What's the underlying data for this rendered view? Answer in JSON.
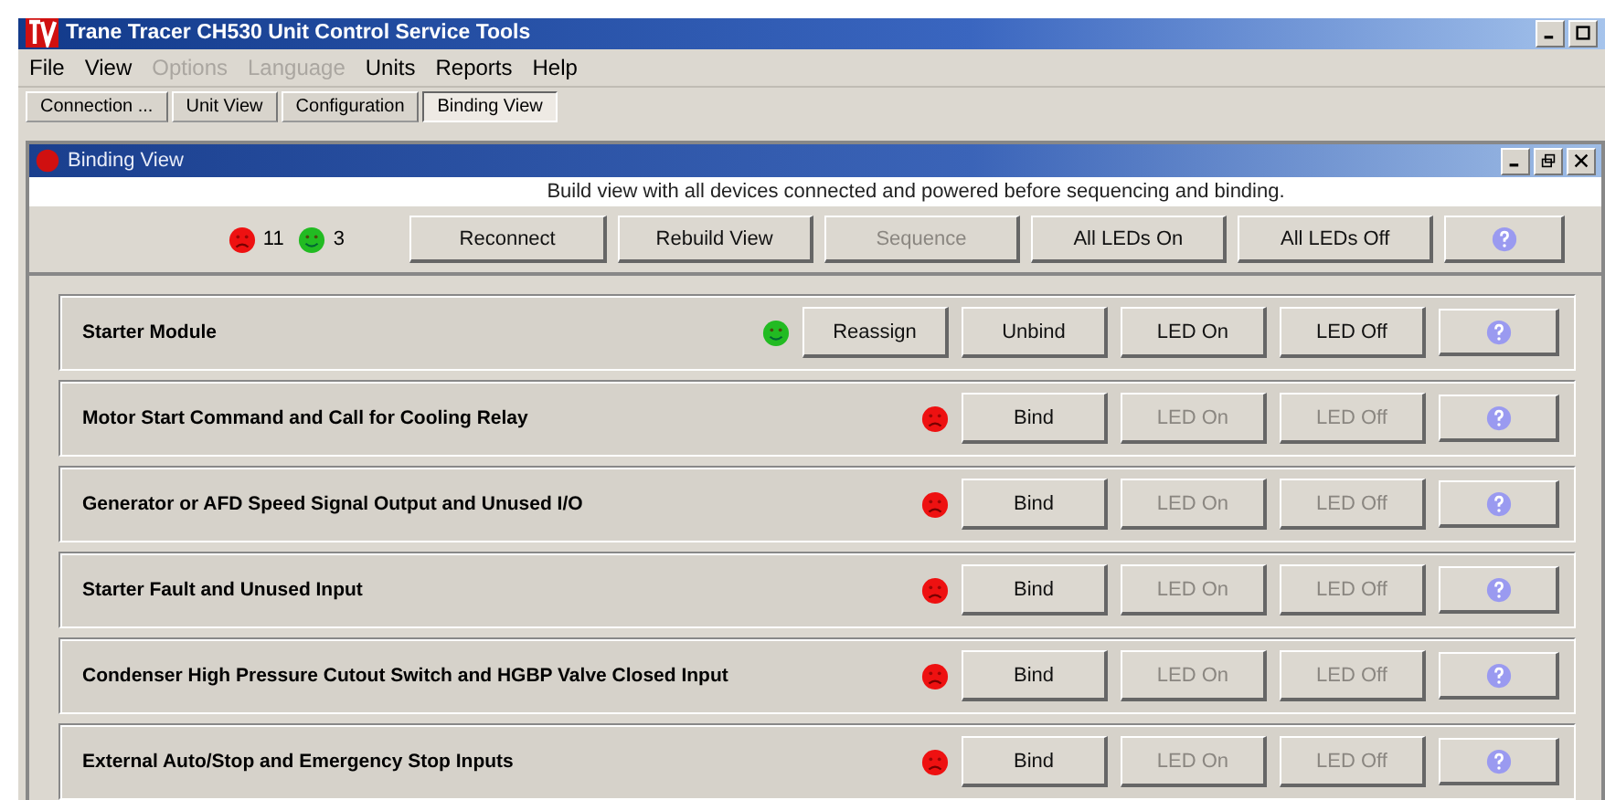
{
  "window": {
    "title": "Trane Tracer CH530 Unit Control Service Tools"
  },
  "menu": [
    {
      "label": "File",
      "disabled": false
    },
    {
      "label": "View",
      "disabled": false
    },
    {
      "label": "Options",
      "disabled": true
    },
    {
      "label": "Language",
      "disabled": true
    },
    {
      "label": "Units",
      "disabled": false
    },
    {
      "label": "Reports",
      "disabled": false
    },
    {
      "label": "Help",
      "disabled": false
    }
  ],
  "tabs": [
    {
      "label": "Connection ...",
      "selected": false
    },
    {
      "label": "Unit View",
      "selected": false
    },
    {
      "label": "Configuration",
      "selected": false
    },
    {
      "label": "Binding View",
      "selected": true
    }
  ],
  "child_window": {
    "title": "Binding View"
  },
  "instruction": "Build view with all devices connected and powered before sequencing and binding.",
  "counts": [
    {
      "bound": false,
      "count": "11"
    },
    {
      "bound": true,
      "count": "3"
    }
  ],
  "toolbar": [
    {
      "label": "Reconnect",
      "disabled": false
    },
    {
      "label": "Rebuild View",
      "disabled": false
    },
    {
      "label": "Sequence",
      "disabled": true
    },
    {
      "label": "All LEDs On",
      "disabled": false
    },
    {
      "label": "All LEDs Off",
      "disabled": false
    }
  ],
  "devices": [
    {
      "name": "Starter Module",
      "bound": true,
      "buttons": [
        {
          "label": "Reassign",
          "disabled": false
        },
        {
          "label": "Unbind",
          "disabled": false
        },
        {
          "label": "LED On",
          "disabled": false
        },
        {
          "label": "LED Off",
          "disabled": false
        }
      ]
    },
    {
      "name": "Motor Start Command and Call for Cooling Relay",
      "bound": false,
      "buttons": [
        {
          "label": "Bind",
          "disabled": false
        },
        {
          "label": "LED On",
          "disabled": true
        },
        {
          "label": "LED Off",
          "disabled": true
        }
      ]
    },
    {
      "name": "Generator or AFD Speed Signal Output and Unused I/O",
      "bound": false,
      "buttons": [
        {
          "label": "Bind",
          "disabled": false
        },
        {
          "label": "LED On",
          "disabled": true
        },
        {
          "label": "LED Off",
          "disabled": true
        }
      ]
    },
    {
      "name": "Starter Fault and Unused Input",
      "bound": false,
      "buttons": [
        {
          "label": "Bind",
          "disabled": false
        },
        {
          "label": "LED On",
          "disabled": true
        },
        {
          "label": "LED Off",
          "disabled": true
        }
      ]
    },
    {
      "name": "Condenser High Pressure Cutout Switch and HGBP Valve Closed Input",
      "bound": false,
      "buttons": [
        {
          "label": "Bind",
          "disabled": false
        },
        {
          "label": "LED On",
          "disabled": true
        },
        {
          "label": "LED Off",
          "disabled": true
        }
      ]
    },
    {
      "name": "External Auto/Stop and Emergency Stop Inputs",
      "bound": false,
      "buttons": [
        {
          "label": "Bind",
          "disabled": false
        },
        {
          "label": "LED On",
          "disabled": true
        },
        {
          "label": "LED Off",
          "disabled": true
        }
      ]
    }
  ]
}
